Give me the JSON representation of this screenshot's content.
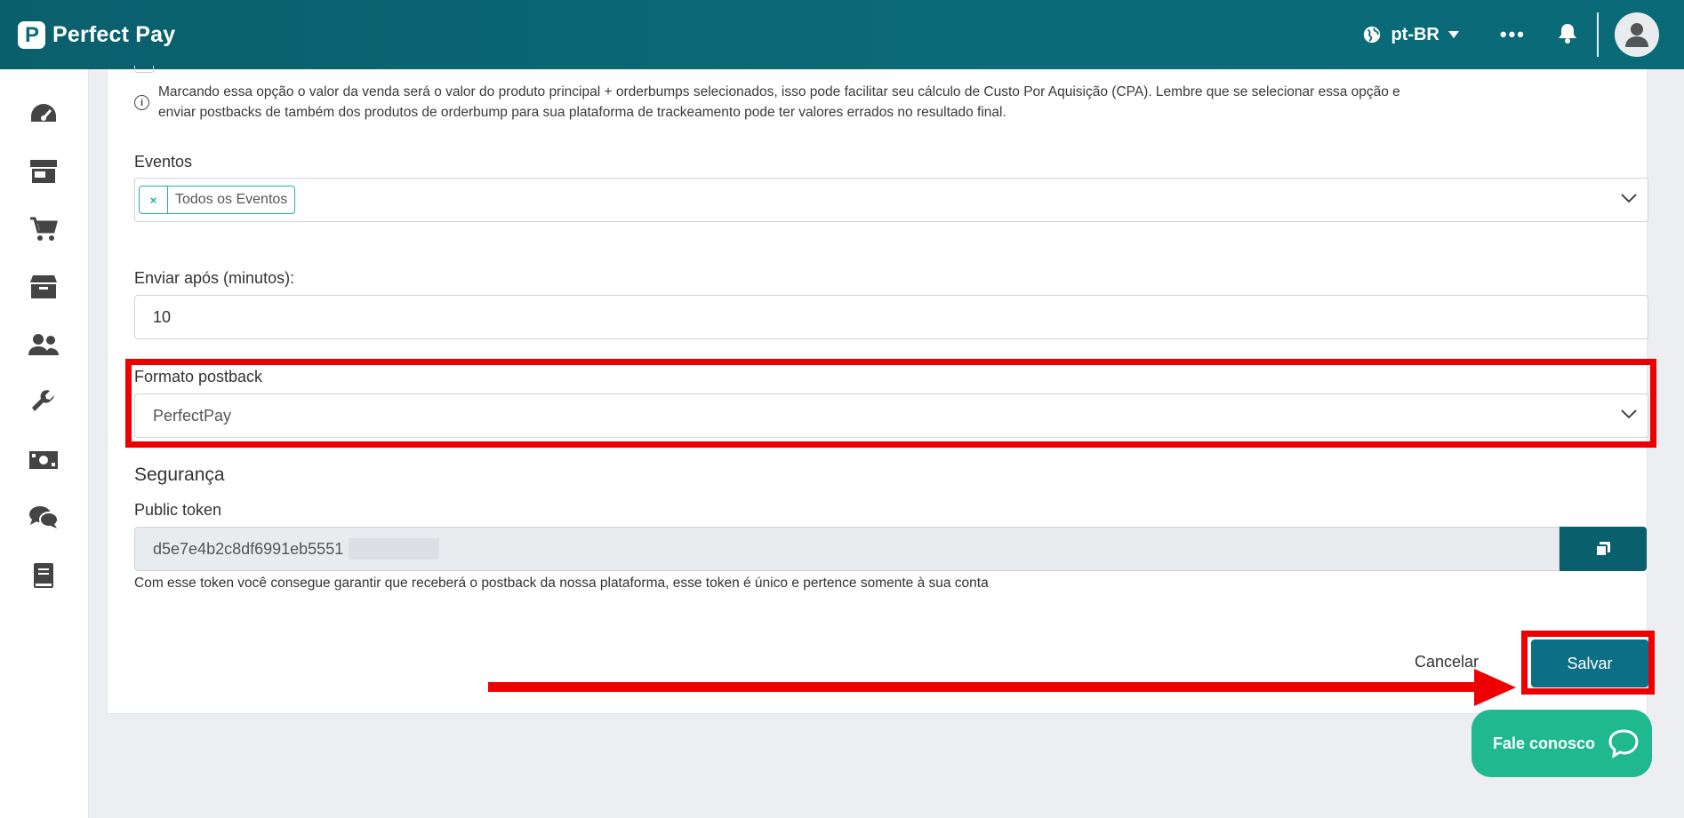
{
  "brand": {
    "name": "Perfect Pay",
    "mark": "P"
  },
  "header": {
    "language": "pt-BR",
    "more": "•••"
  },
  "sidebar": {
    "items": [
      {
        "icon": "dashboard-icon"
      },
      {
        "icon": "store-icon"
      },
      {
        "icon": "cart-icon"
      },
      {
        "icon": "box-icon"
      },
      {
        "icon": "users-icon"
      },
      {
        "icon": "wrench-icon"
      },
      {
        "icon": "money-icon"
      },
      {
        "icon": "chat-icon"
      },
      {
        "icon": "book-icon"
      }
    ]
  },
  "form": {
    "info_text": "Marcando essa opção o valor da venda será o valor do produto principal + orderbumps selecionados, isso pode facilitar seu cálculo de Custo Por Aquisição (CPA). Lembre que se selecionar essa opção e enviar postbacks de também dos produtos de orderbump para sua plataforma de trackeamento pode ter valores errados no resultado final.",
    "events_label": "Eventos",
    "events_tag": "Todos os Eventos",
    "events_tag_remove": "×",
    "delay_label": "Enviar após (minutos):",
    "delay_value": "10",
    "format_label": "Formato postback",
    "format_value": "PerfectPay",
    "security_title": "Segurança",
    "token_label": "Public token",
    "token_value": "d5e7e4b2c8df6991eb5551",
    "token_help": "Com esse token você consegue garantir que receberá o postback da nossa plataforma, esse token é único e pertence somente à sua conta",
    "cancel_label": "Cancelar",
    "save_label": "Salvar"
  },
  "support": {
    "label": "Fale conosco"
  },
  "colors": {
    "header": "#0b6b78",
    "primary": "#0c6f86",
    "tag": "#1fb3a1",
    "support": "#1fb88f",
    "annotation": "#ee0000"
  }
}
